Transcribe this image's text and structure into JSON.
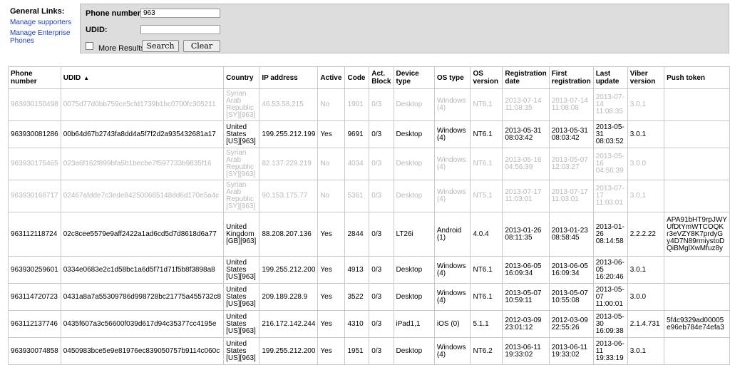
{
  "links": {
    "header": "General Links:",
    "items": [
      "Manage supporters",
      "Manage Enterprise Phones"
    ]
  },
  "search": {
    "phone_label": "Phone number:",
    "phone_value": "963",
    "udid_label": "UDID:",
    "udid_value": "",
    "more_results_label": "More Results",
    "search_button": "Search",
    "clear_button": "Clear"
  },
  "table": {
    "sort_indicator": "▲",
    "columns": [
      "Phone number",
      "UDID",
      "Country",
      "IP address",
      "Active",
      "Code",
      "Act. Block",
      "Device type",
      "OS type",
      "OS version",
      "Registration date",
      "First registration",
      "Last update",
      "Viber version",
      "Push token"
    ],
    "rows": [
      {
        "active": false,
        "cells": [
          "963930150498",
          "0075d77d0bb759ce5cfd1739b1bc0700fc305211",
          "Syrian Arab Republic [SY][963]",
          "46.53.58.215",
          "No",
          "1901",
          "0/3",
          "Desktop",
          "Windows (4)",
          "NT6.1",
          "2013-07-14 11:08:35",
          "2013-07-14 11:08:08",
          "2013-07-14 11:08:35",
          "3.0.1",
          ""
        ]
      },
      {
        "active": true,
        "cells": [
          "963930081286",
          "00b64d67b2743fa8dd4a5f7f2d2a935432681a17",
          "United States [US][963]",
          "199.255.212.199",
          "Yes",
          "9691",
          "0/3",
          "Desktop",
          "Windows (4)",
          "NT6.1",
          "2013-05-31 08:03:42",
          "2013-05-31 08:03:42",
          "2013-05-31 08:03:52",
          "3.0.1",
          ""
        ]
      },
      {
        "active": false,
        "cells": [
          "963930175465",
          "023a6f162f899bfa5b1becbe7f597733b9835f16",
          "Syrian Arab Republic [SY][963]",
          "82.137.229.219",
          "No",
          "4034",
          "0/3",
          "Desktop",
          "Windows (4)",
          "NT6.1",
          "2013-05-16 04:56:39",
          "2013-05-07 12:03:27",
          "2013-05-16 04:56:39",
          "3.0.0",
          ""
        ]
      },
      {
        "active": false,
        "cells": [
          "963930168717",
          "02467afdde7c3ede842500685148dd6d170e5a4c",
          "Syrian Arab Republic [SY][963]",
          "90.153.175.77",
          "No",
          "5361",
          "0/3",
          "Desktop",
          "Windows (4)",
          "NT5.1",
          "2013-07-17 11:03:01",
          "2013-07-17 11:03:01",
          "2013-07-17 11:03:01",
          "3.0.1",
          ""
        ]
      },
      {
        "active": true,
        "cells": [
          "963112118724",
          "02c8cee5579e9aff2422a1ad6cd5d7d8618d6a77",
          "United Kingdom [GB][963]",
          "88.208.207.136",
          "Yes",
          "2844",
          "0/3",
          "LT26i",
          "Android (1)",
          "4.0.4",
          "2013-01-26 08:11:35",
          "2013-01-23 08:58:45",
          "2013-01-26 08:14:58",
          "2.2.2.22",
          "APA91bHT9rpJWY\nUfDtYmWTCOQK\nr3eVZY8K7prdyG\ny4D7N89rmiystoD\nQiBMglXwMfuz8y"
        ]
      },
      {
        "active": true,
        "cells": [
          "963930259601",
          "0334e0683e2c1d58bc1a6d5f71d71f5b8f3898a8",
          "United States [US][963]",
          "199.255.212.200",
          "Yes",
          "4913",
          "0/3",
          "Desktop",
          "Windows (4)",
          "NT6.1",
          "2013-06-05 16:09:34",
          "2013-06-05 16:09:34",
          "2013-06-05 16:20:46",
          "3.0.1",
          ""
        ]
      },
      {
        "active": true,
        "cells": [
          "963114720723",
          "0431a8a7a55309786d998728bc21775a455732c8",
          "United States [US][963]",
          "209.189.228.9",
          "Yes",
          "3522",
          "0/3",
          "Desktop",
          "Windows (4)",
          "NT6.1",
          "2013-05-07 10:59:11",
          "2013-05-07 10:55:08",
          "2013-05-07 11:00:01",
          "3.0.0",
          ""
        ]
      },
      {
        "active": true,
        "cells": [
          "963112137746",
          "0435f607a3c56600f039d617d94c35377cc4195e",
          "United States [US][963]",
          "216.172.142.244",
          "Yes",
          "4310",
          "0/3",
          "iPad1,1",
          "iOS (0)",
          "5.1.1",
          "2012-03-09 23:01:12",
          "2012-03-09 22:55:26",
          "2013-05-30 16:09:38",
          "2.1.4.731",
          "5f4c9329ad00005\ne96eb784e74efa3"
        ]
      },
      {
        "active": true,
        "cells": [
          "963930074858",
          "0450983bce5e9e81976ec839050757b9114c060c",
          "United States [US][963]",
          "199.255.212.200",
          "Yes",
          "1951",
          "0/3",
          "Desktop",
          "Windows (4)",
          "NT6.2",
          "2013-06-11 19:33:02",
          "2013-06-11 19:33:02",
          "2013-06-11 19:33:19",
          "3.0.1",
          ""
        ]
      }
    ]
  }
}
